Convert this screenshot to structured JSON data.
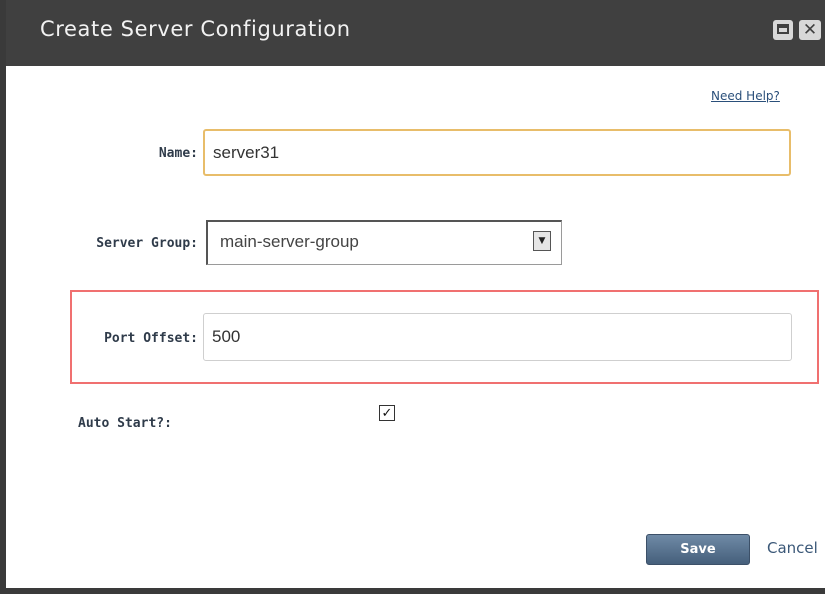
{
  "dialog": {
    "title": "Create Server Configuration",
    "maximize_icon": "maximize-icon",
    "close_icon": "close-icon",
    "close_glyph": "✕",
    "help_link": "Need Help?"
  },
  "form": {
    "name_label": "Name:",
    "name_value": "server31",
    "server_group_label": "Server Group:",
    "server_group_value": "main-server-group",
    "port_offset_label": "Port Offset:",
    "port_offset_value": "500",
    "auto_start_label": "Auto Start?:",
    "auto_start_checked": true,
    "check_glyph": "✓"
  },
  "actions": {
    "save_label": "Save",
    "cancel_label": "Cancel"
  },
  "colors": {
    "titlebar": "#404040",
    "name_focus_border": "#e8bd6a",
    "highlight_border": "#f07070",
    "save_button": "#5a7490"
  }
}
